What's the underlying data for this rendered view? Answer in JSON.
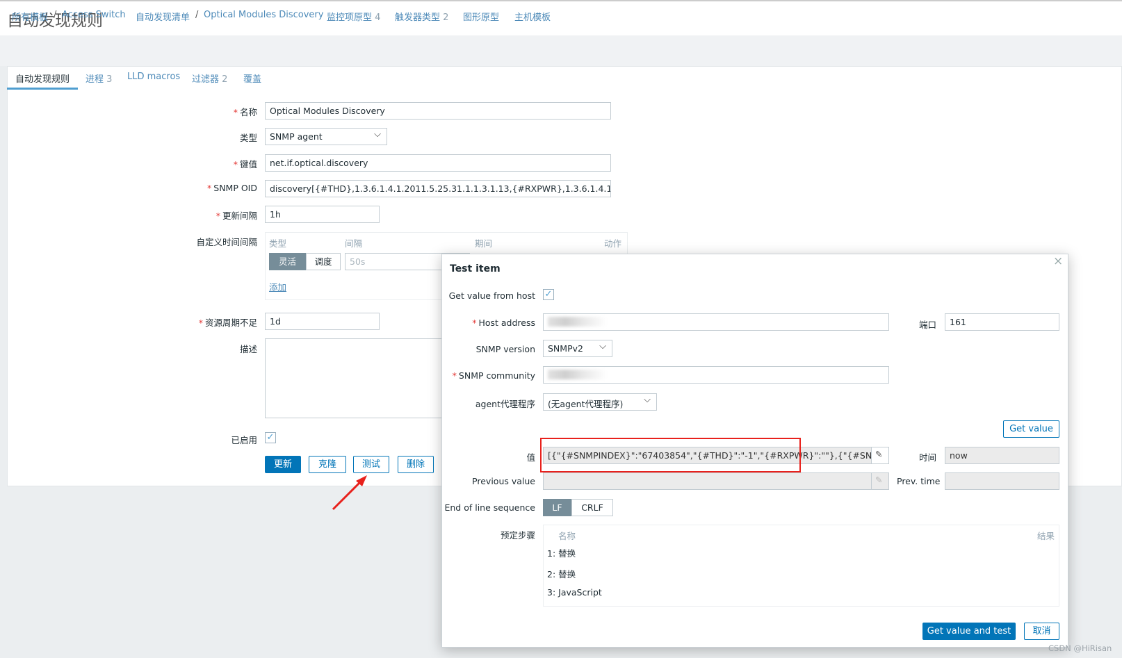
{
  "header": {
    "title": "自动发现规则"
  },
  "breadcrumb": {
    "all_templates": "所有模板",
    "host": "Access Switch",
    "discovery_list": "自动发现清单",
    "current": "Optical Modules Discovery",
    "item_prototypes": "监控项原型",
    "item_prototypes_count": "4",
    "trigger_prototypes": "触发器类型",
    "trigger_prototypes_count": "2",
    "graph_prototypes": "图形原型",
    "host_prototypes": "主机模板"
  },
  "tabs": [
    {
      "label": "自动发现规则"
    },
    {
      "label": "进程",
      "count": "3"
    },
    {
      "label": "LLD macros"
    },
    {
      "label": "过滤器",
      "count": "2"
    },
    {
      "label": "覆盖"
    }
  ],
  "form": {
    "name_label": "名称",
    "name_value": "Optical Modules Discovery",
    "type_label": "类型",
    "type_value": "SNMP agent",
    "key_label": "键值",
    "key_value": "net.if.optical.discovery",
    "oid_label": "SNMP OID",
    "oid_value": "discovery[{#THD},1.3.6.1.4.1.2011.5.25.31.1.1.3.1.13,{#RXPWR},1.3.6.1.4.1.2011.5",
    "interval_label": "更新间隔",
    "interval_value": "1h",
    "custom_label": "自定义时间间隔",
    "custom": {
      "col_type": "类型",
      "col_interval": "间隔",
      "col_period": "期间",
      "col_action": "动作",
      "flexible": "灵活",
      "scheduling": "调度",
      "interval_placeholder": "50s",
      "add": "添加"
    },
    "lifetime_label": "资源周期不足",
    "lifetime_value": "1d",
    "desc_label": "描述",
    "enabled_label": "已启用",
    "enabled": true,
    "buttons": {
      "update": "更新",
      "clone": "克隆",
      "test": "测试",
      "delete": "删除"
    }
  },
  "dialog": {
    "title": "Test item",
    "close": "×",
    "get_from_host_label": "Get value from host",
    "get_from_host": true,
    "host_label": "Host address",
    "port_label": "端口",
    "port_value": "161",
    "snmp_version_label": "SNMP version",
    "snmp_version_value": "SNMPv2",
    "community_label": "SNMP community",
    "proxy_label": "agent代理程序",
    "proxy_value": "(无agent代理程序)",
    "get_value_button": "Get value",
    "value_label": "值",
    "value": "[{\"{#SNMPINDEX}\":\"67403854\",\"{#THD}\":\"-1\",\"{#RXPWR}\":\"\"},{\"{#SNMPIND...",
    "time_label": "时间",
    "time_value": "now",
    "prev_value_label": "Previous value",
    "prev_time_label": "Prev. time",
    "eol_label": "End of line sequence",
    "eol_options": [
      "LF",
      "CRLF"
    ],
    "eol_selected": "LF",
    "steps_label": "预定步骤",
    "steps_col_name": "名称",
    "steps_col_result": "结果",
    "steps": [
      {
        "n": "1:",
        "name": "替换"
      },
      {
        "n": "2:",
        "name": "替换"
      },
      {
        "n": "3:",
        "name": "JavaScript"
      }
    ],
    "test_button": "Get value and test",
    "cancel_button": "取消"
  },
  "watermark": "CSDN @HiRisan",
  "colors": {
    "accent": "#0275b8",
    "link": "#4d8ab8",
    "highlight": "#e8211c"
  }
}
